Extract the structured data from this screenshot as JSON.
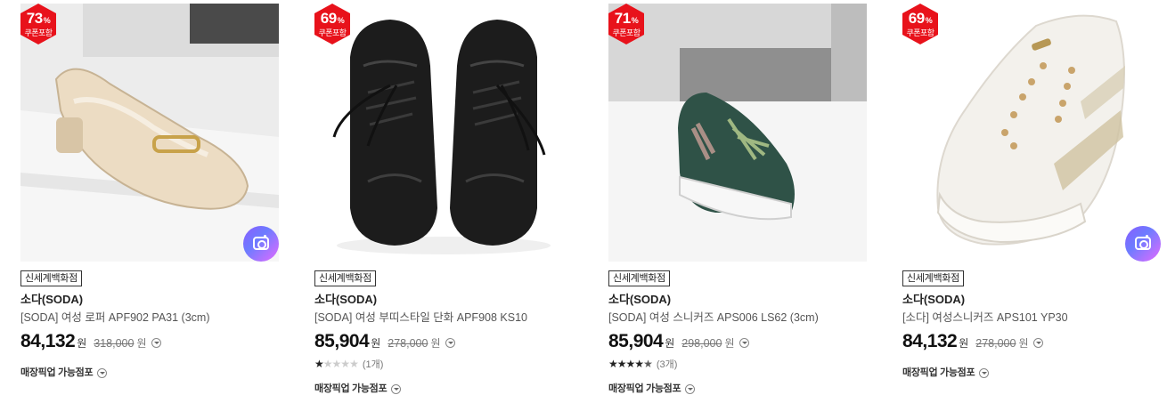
{
  "products": [
    {
      "discount": "73",
      "discount_unit": "%",
      "coupon_label": "쿠폰포함",
      "store": "신세계백화점",
      "brand": "소다(SODA)",
      "name": "[SODA] 여성 로퍼 APF902 PA31 (3cm)",
      "price": "84,132",
      "price_unit": "원",
      "original_price": "318,000",
      "original_unit": "원",
      "rating_count": "",
      "pickup": "매장픽업 가능점포",
      "image_icon": "loafer-shoe-image",
      "has_camera": true
    },
    {
      "discount": "69",
      "discount_unit": "%",
      "coupon_label": "쿠폰포함",
      "store": "신세계백화점",
      "brand": "소다(SODA)",
      "name": "[SODA] 여성 부띠스타일 단화 APF908 KS10",
      "price": "85,904",
      "price_unit": "원",
      "original_price": "278,000",
      "original_unit": "원",
      "rating_stars": 1,
      "rating_count": "(1개)",
      "pickup": "매장픽업 가능점포",
      "image_icon": "oxford-shoes-image",
      "has_camera": false
    },
    {
      "discount": "71",
      "discount_unit": "%",
      "coupon_label": "쿠폰포함",
      "store": "신세계백화점",
      "brand": "소다(SODA)",
      "name": "[SODA] 여성 스니커즈 APS006 LS62 (3cm)",
      "price": "85,904",
      "price_unit": "원",
      "original_price": "298,000",
      "original_unit": "원",
      "rating_stars": 4.5,
      "rating_count": "(3개)",
      "pickup": "매장픽업 가능점포",
      "image_icon": "green-sneaker-image",
      "has_camera": false
    },
    {
      "discount": "69",
      "discount_unit": "%",
      "coupon_label": "쿠폰포함",
      "store": "신세계백화점",
      "brand": "소다(SODA)",
      "name": "[소다] 여성스니커즈 APS101 YP30",
      "price": "84,132",
      "price_unit": "원",
      "original_price": "278,000",
      "original_unit": "원",
      "rating_count": "",
      "pickup": "매장픽업 가능점포",
      "image_icon": "white-sneaker-image",
      "has_camera": true
    }
  ],
  "colors": {
    "badge_red": "#e8121b",
    "text_dark": "#222222",
    "text_muted": "#777777"
  },
  "icons": {
    "badge": "hexagon-discount-badge",
    "camera": "camera-icon",
    "info": "chevron-down-circle-icon",
    "star": "star-icon"
  }
}
